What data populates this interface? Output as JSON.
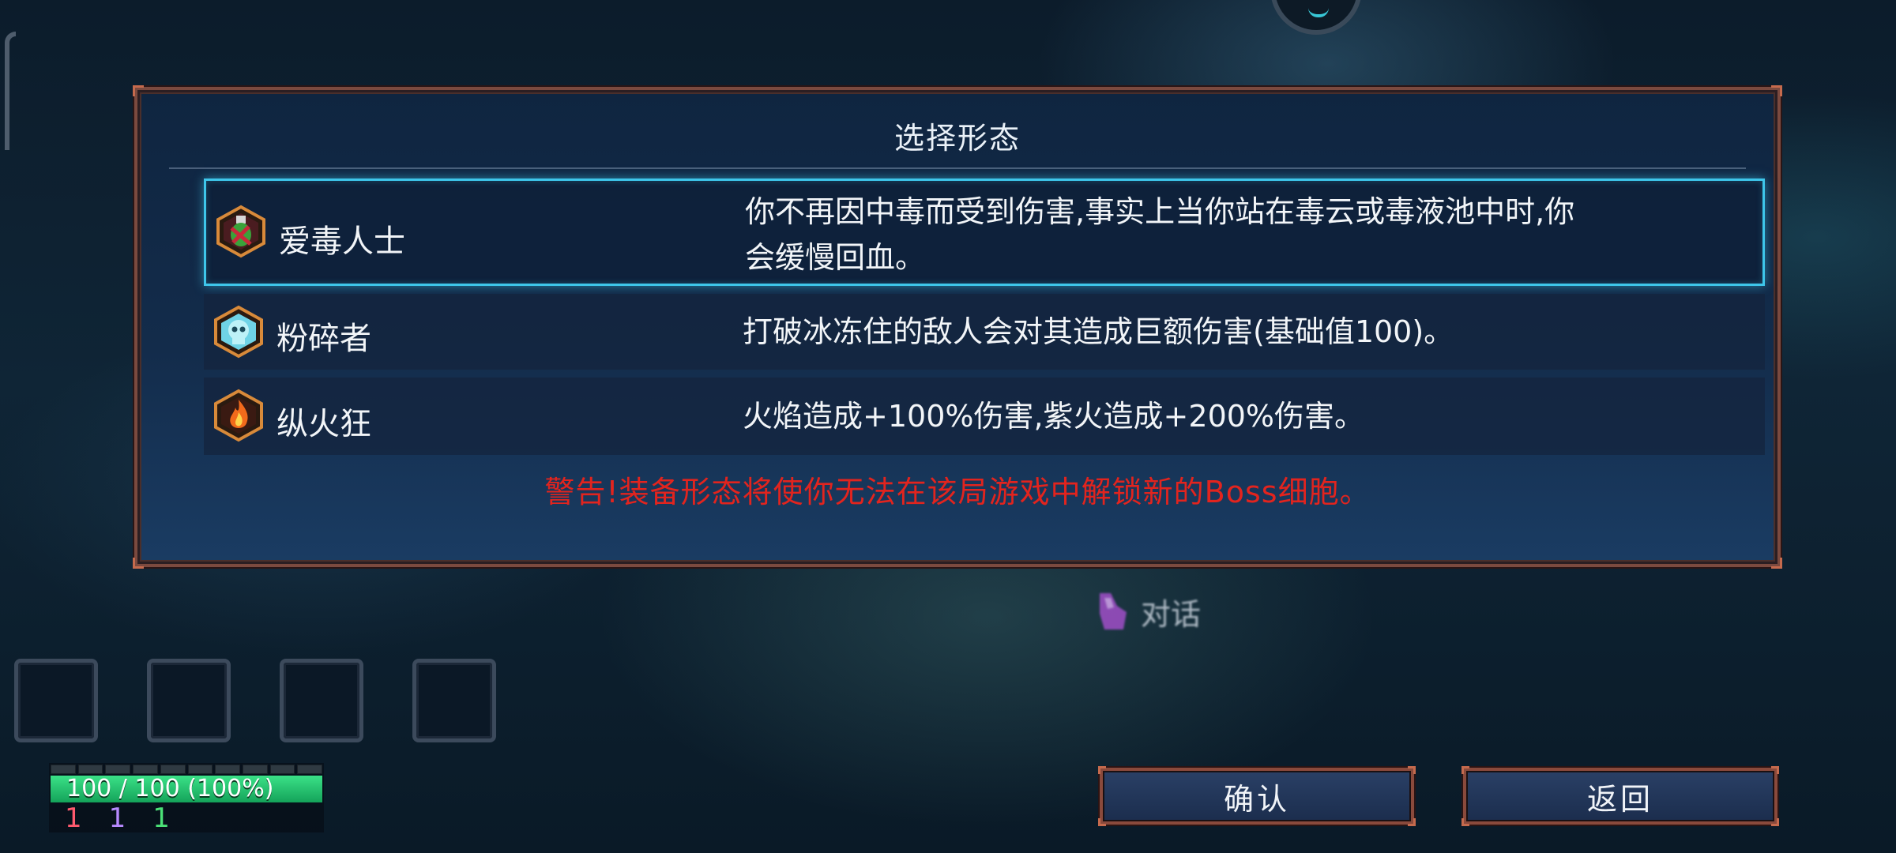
{
  "dialog": {
    "title": "选择形态",
    "options": [
      {
        "icon": "poison-bottle-icon",
        "name": "爱毒人士",
        "desc_line1": "你不再因中毒而受到伤害,事实上当你站在毒云或毒液池中时,你",
        "desc_line2": "会缓慢回血。",
        "selected": true
      },
      {
        "icon": "ice-skull-icon",
        "name": "粉碎者",
        "desc_line1": "打破冰冻住的敌人会对其造成巨额伤害(基础值100)。",
        "selected": false
      },
      {
        "icon": "flame-icon",
        "name": "纵火狂",
        "desc_line1": "火焰造成+100%伤害,紫火造成+200%伤害。",
        "selected": false
      }
    ],
    "warning": "警告!装备形态将使你无法在该局游戏中解锁新的Boss细胞。"
  },
  "talk_prompt": {
    "icon": "hand-icon",
    "label": "对话"
  },
  "inventory_slots": 4,
  "hud": {
    "health_text": "100 / 100 (100%)",
    "health_fraction": 1.0,
    "brutality": "1",
    "tactics": "1",
    "survival": "1"
  },
  "buttons": {
    "confirm": "确认",
    "back": "返回"
  },
  "colors": {
    "selected_border": "#3ec6ea",
    "warning": "#e2241e",
    "panel_border": "#7b4a3f",
    "health_fill": "#22c46e"
  }
}
